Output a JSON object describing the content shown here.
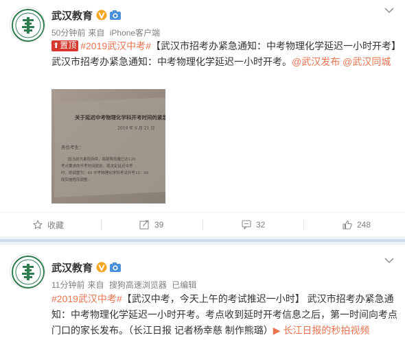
{
  "posts": [
    {
      "author": "武汉教育",
      "time": "50分钟前",
      "source_prefix": "来自",
      "source": "iPhone客户端",
      "pin_label": "置顶",
      "segments": [
        {
          "text": "#2019武汉中考#",
          "style": "link"
        },
        {
          "text": "【武汉市招考办紧急通知：中考物理化学延迟一小时开考】武汉市招考办紧急通知：中考物理化学延迟一小时开考。",
          "style": "plain"
        },
        {
          "text": "@武汉发布",
          "style": "link"
        },
        {
          "text": " ",
          "style": "plain"
        },
        {
          "text": "@武汉同城",
          "style": "link"
        }
      ],
      "photo": {
        "title": "关于延迟中考物理化学科开考时间的紧急通知",
        "date": "2019 年 6 月 21 日",
        "greeting": "各位考生：",
        "lines": [
          "因当前大暴雨持续，局部降雨量已达120",
          "考点要求的开考时间提前，现决定延迟中考",
          "时，即调整为：40 中考物理化学科考试开考10：00",
          "段实施程序调整。"
        ]
      },
      "actions": {
        "favorite": "收藏",
        "forward": "39",
        "comment": "32",
        "like": "248"
      }
    },
    {
      "author": "武汉教育",
      "time": "11分钟前",
      "source_prefix": "来自",
      "source": "搜狗高速浏览器",
      "edited": "已编辑",
      "segments": [
        {
          "text": "#2019武汉中考#",
          "style": "link"
        },
        {
          "text": "【武汉中考，今天上午的考试推迟一小时】 武汉市招考办紧急通知：中考物理化学延迟一小时开考。考点收到延时开考信息之后，第一时间向考点门口的家长发布。（长江日报 记者杨幸慈 制作熊璐）",
          "style": "plain"
        },
        {
          "text": "▶ 长江日报的秒拍视频",
          "style": "link"
        }
      ]
    }
  ],
  "colors": {
    "link": "#eb7350",
    "pin": "#d63a2e",
    "divider": "#c9dcef",
    "verified": "#f5a623",
    "camera": "#4a90d9"
  }
}
